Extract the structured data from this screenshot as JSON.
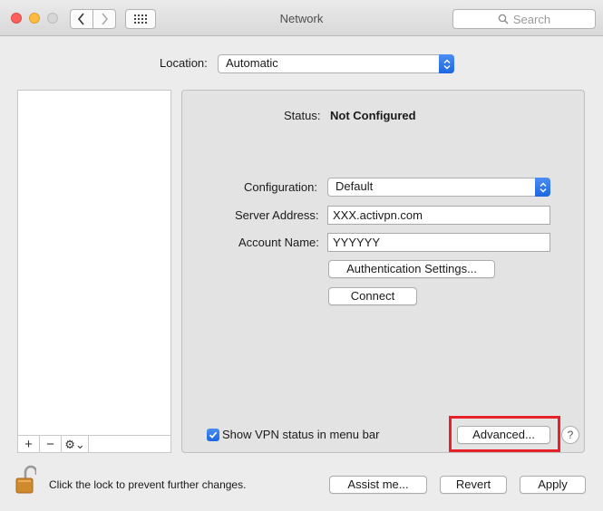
{
  "window": {
    "title": "Network"
  },
  "search": {
    "placeholder": "Search"
  },
  "location": {
    "label": "Location:",
    "value": "Automatic"
  },
  "sidebar": {
    "toolbar": {
      "add": "+",
      "remove": "−",
      "gear": "⚙⌄"
    }
  },
  "status": {
    "label": "Status:",
    "value": "Not Configured"
  },
  "configuration": {
    "label": "Configuration:",
    "value": "Default"
  },
  "server_address": {
    "label": "Server Address:",
    "value": "XXX.activpn.com"
  },
  "account_name": {
    "label": "Account Name:",
    "value": "YYYYYY"
  },
  "buttons": {
    "auth_settings": "Authentication Settings...",
    "connect": "Connect",
    "advanced": "Advanced...",
    "help": "?",
    "assist": "Assist me...",
    "revert": "Revert",
    "apply": "Apply"
  },
  "vpn_menu_checkbox": {
    "label": "Show VPN status in menu bar",
    "checked": true
  },
  "lock": {
    "text": "Click the lock to prevent further changes."
  },
  "colors": {
    "accent": "#1c66e0",
    "highlight": "#e8202a"
  },
  "icons": [
    "back-icon",
    "forward-icon",
    "grid-icon",
    "search-icon",
    "popup-arrows-icon",
    "checkmark-icon",
    "lock-icon",
    "gear-icon"
  ]
}
